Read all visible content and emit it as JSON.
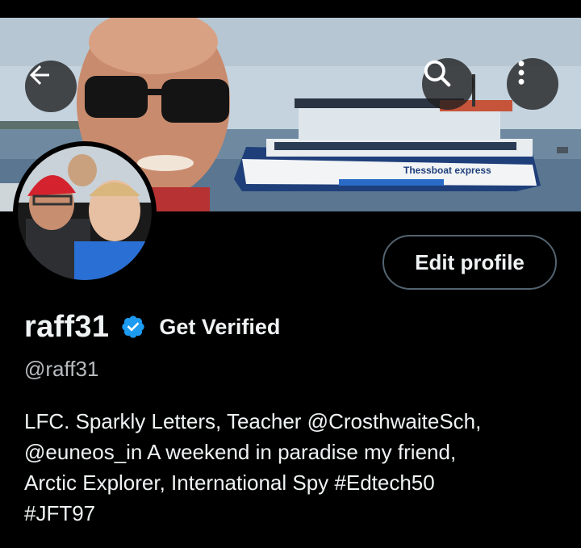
{
  "header": {
    "back_icon": "arrow-left-icon",
    "search_icon": "search-icon",
    "more_icon": "more-vertical-icon"
  },
  "banner": {
    "boat_name": "Thessboat express"
  },
  "profile": {
    "edit_label": "Edit profile",
    "display_name": "raff31",
    "verified_color": "#1d9bf0",
    "get_verified_label": "Get Verified",
    "handle": "@raff31",
    "bio_lines": [
      "LFC.  Sparkly Letters,  Teacher @CrosthwaiteSch,",
      "@euneos_in A weekend in paradise my friend,",
      "Arctic Explorer, International Spy #Edtech50",
      "#JFT97"
    ]
  }
}
